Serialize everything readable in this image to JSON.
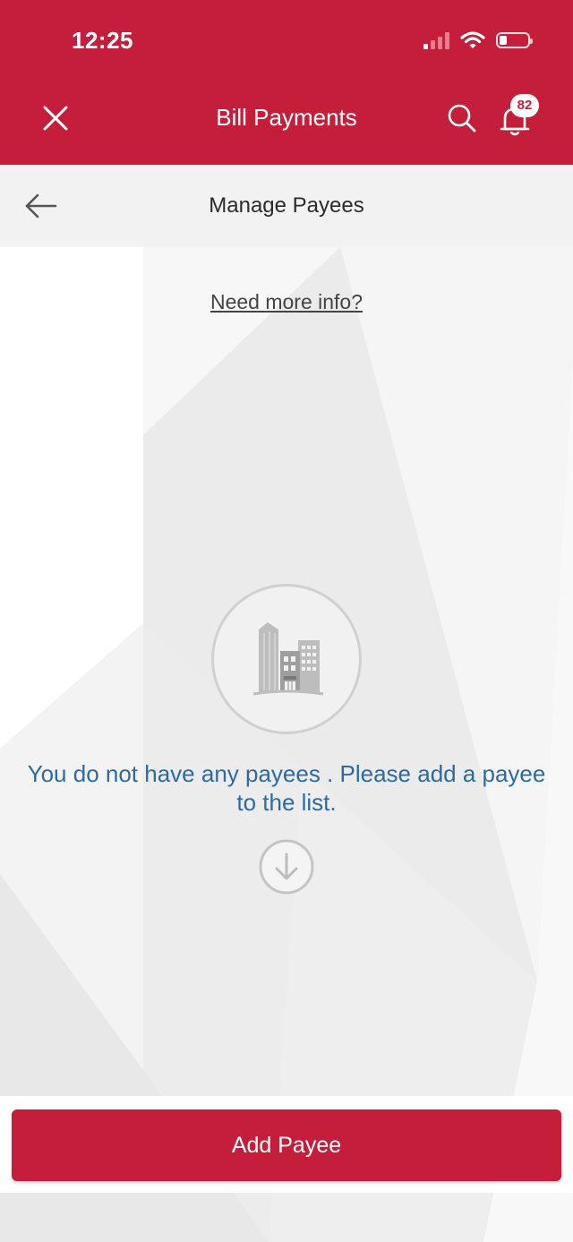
{
  "status_bar": {
    "time": "12:25"
  },
  "header": {
    "title": "Bill Payments",
    "notification_count": "82",
    "icons": {
      "close": "close-icon",
      "search": "search-icon",
      "notifications": "bell-icon"
    },
    "color": "#c41e3a"
  },
  "subheader": {
    "title": "Manage Payees",
    "back_icon": "back-arrow-icon"
  },
  "content": {
    "info_link": "Need more info?",
    "empty_message": "You do not have any payees . Please add a payee to the list.",
    "illustration_icon": "buildings-icon",
    "scroll_icon": "arrow-down-circle-icon"
  },
  "footer": {
    "add_button_label": "Add Payee"
  },
  "colors": {
    "brand": "#c41e3a",
    "message_text": "#2e6aa0"
  }
}
